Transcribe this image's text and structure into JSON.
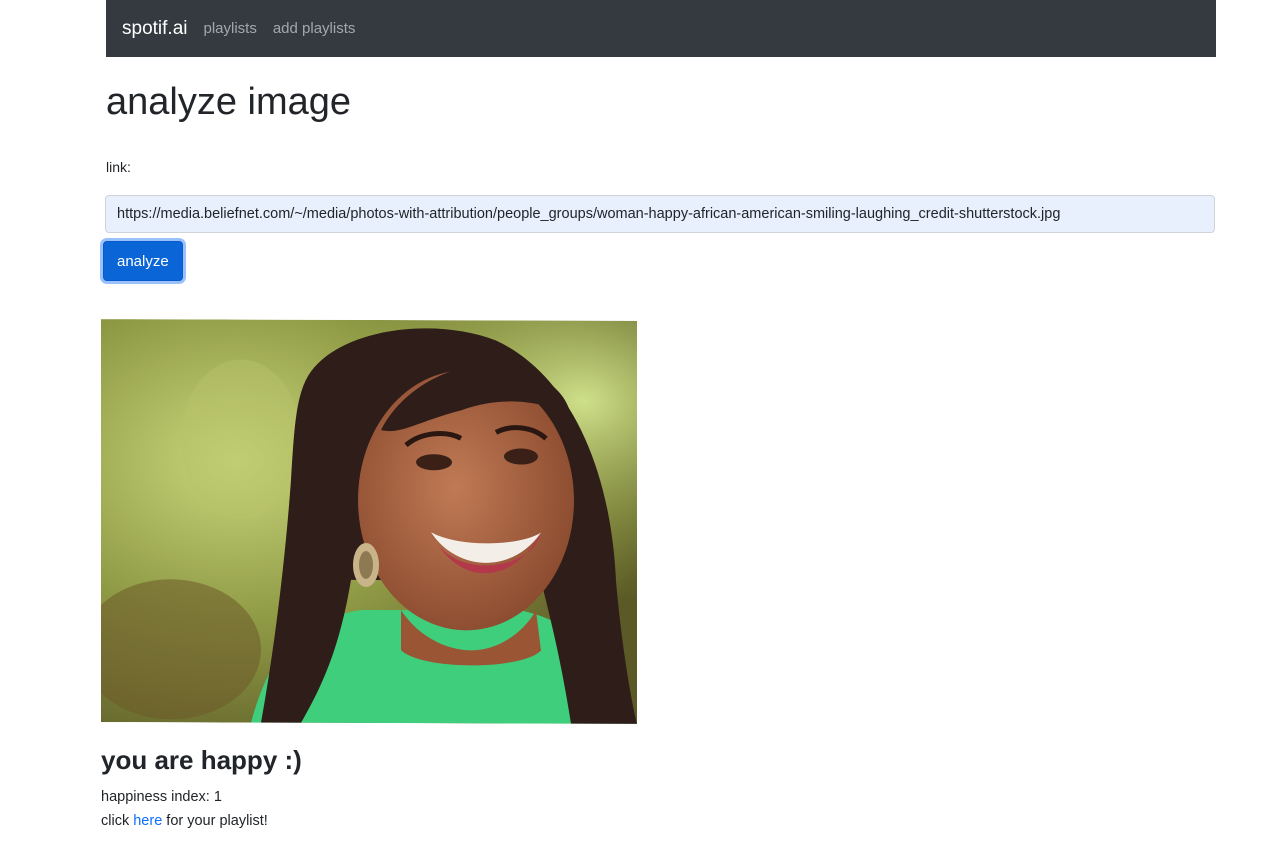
{
  "navbar": {
    "brand": "spotif.ai",
    "links": [
      {
        "label": "playlists"
      },
      {
        "label": "add playlists"
      }
    ],
    "background": "#343a40"
  },
  "page": {
    "title": "analyze image"
  },
  "form": {
    "link_label": "link:",
    "link_value": "https://media.beliefnet.com/~/media/photos-with-attribution/people_groups/woman-happy-african-american-smiling-laughing_credit-shutterstock.jpg",
    "analyze_label": "analyze",
    "accent_color": "#0a66d6"
  },
  "result": {
    "image_icon": "analyzed-photo",
    "title": "you are happy :)",
    "happiness_label": "happiness index: 1",
    "click_prefix": "click ",
    "link_text": "here",
    "click_suffix": " for your playlist!"
  }
}
